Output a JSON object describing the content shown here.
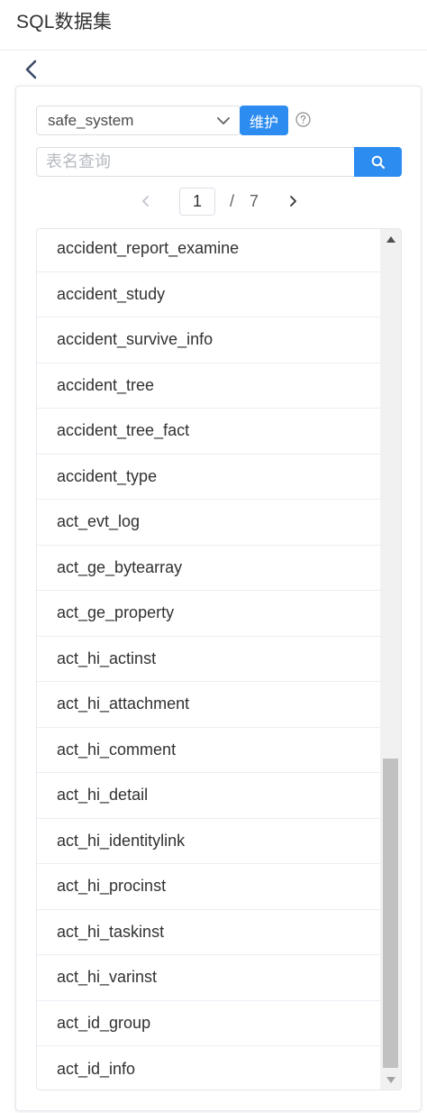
{
  "header": {
    "title": "SQL数据集"
  },
  "icons": {
    "back": "chevron-left-icon",
    "select_arrow": "chevron-down-icon",
    "help": "question-circle-icon",
    "search": "search-icon",
    "prev": "chevron-left-icon",
    "next": "chevron-right-icon"
  },
  "datasource": {
    "selected": "safe_system"
  },
  "maintain_label": "维护",
  "search": {
    "placeholder": "表名查询",
    "value": ""
  },
  "pager": {
    "current": "1",
    "separator": "/",
    "total": "7"
  },
  "colors": {
    "primary": "#2d8cf0",
    "border": "#dcdfe6",
    "scroll_thumb": "#c1c1c1"
  },
  "tables": [
    "accident_report_examine",
    "accident_study",
    "accident_survive_info",
    "accident_tree",
    "accident_tree_fact",
    "accident_type",
    "act_evt_log",
    "act_ge_bytearray",
    "act_ge_property",
    "act_hi_actinst",
    "act_hi_attachment",
    "act_hi_comment",
    "act_hi_detail",
    "act_hi_identitylink",
    "act_hi_procinst",
    "act_hi_taskinst",
    "act_hi_varinst",
    "act_id_group",
    "act_id_info"
  ]
}
